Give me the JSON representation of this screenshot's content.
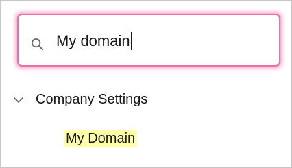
{
  "search": {
    "value": "My domain",
    "icon": "search-icon"
  },
  "tree": {
    "section": {
      "label": "Company Settings",
      "icon": "chevron-down-icon",
      "expanded": true
    },
    "items": [
      {
        "label": "My Domain",
        "highlighted": true
      }
    ]
  },
  "colors": {
    "focus_ring": "#ec6fa6",
    "highlight": "#ffffa6",
    "text": "#181818"
  }
}
